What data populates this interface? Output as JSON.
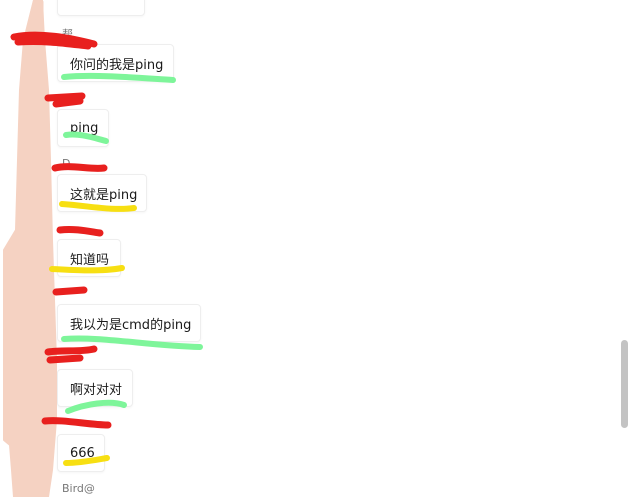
{
  "chat": {
    "senders": [
      "帮",
      "D…",
      "Bird@"
    ],
    "messages": [
      {
        "text": ""
      },
      {
        "text": "你问的我是ping"
      },
      {
        "text": "ping"
      },
      {
        "text": "这就是ping"
      },
      {
        "text": "知道吗"
      },
      {
        "text": "我以为是cmd的ping"
      },
      {
        "text": "啊对对对"
      },
      {
        "text": "666"
      }
    ]
  },
  "colors": {
    "avatar_mask": "#f5d2c2",
    "redaction_red": "#e8201e",
    "highlight_green": "#7ef59a",
    "highlight_yellow": "#f7df12",
    "scrollbar": "#c3c3c3"
  }
}
